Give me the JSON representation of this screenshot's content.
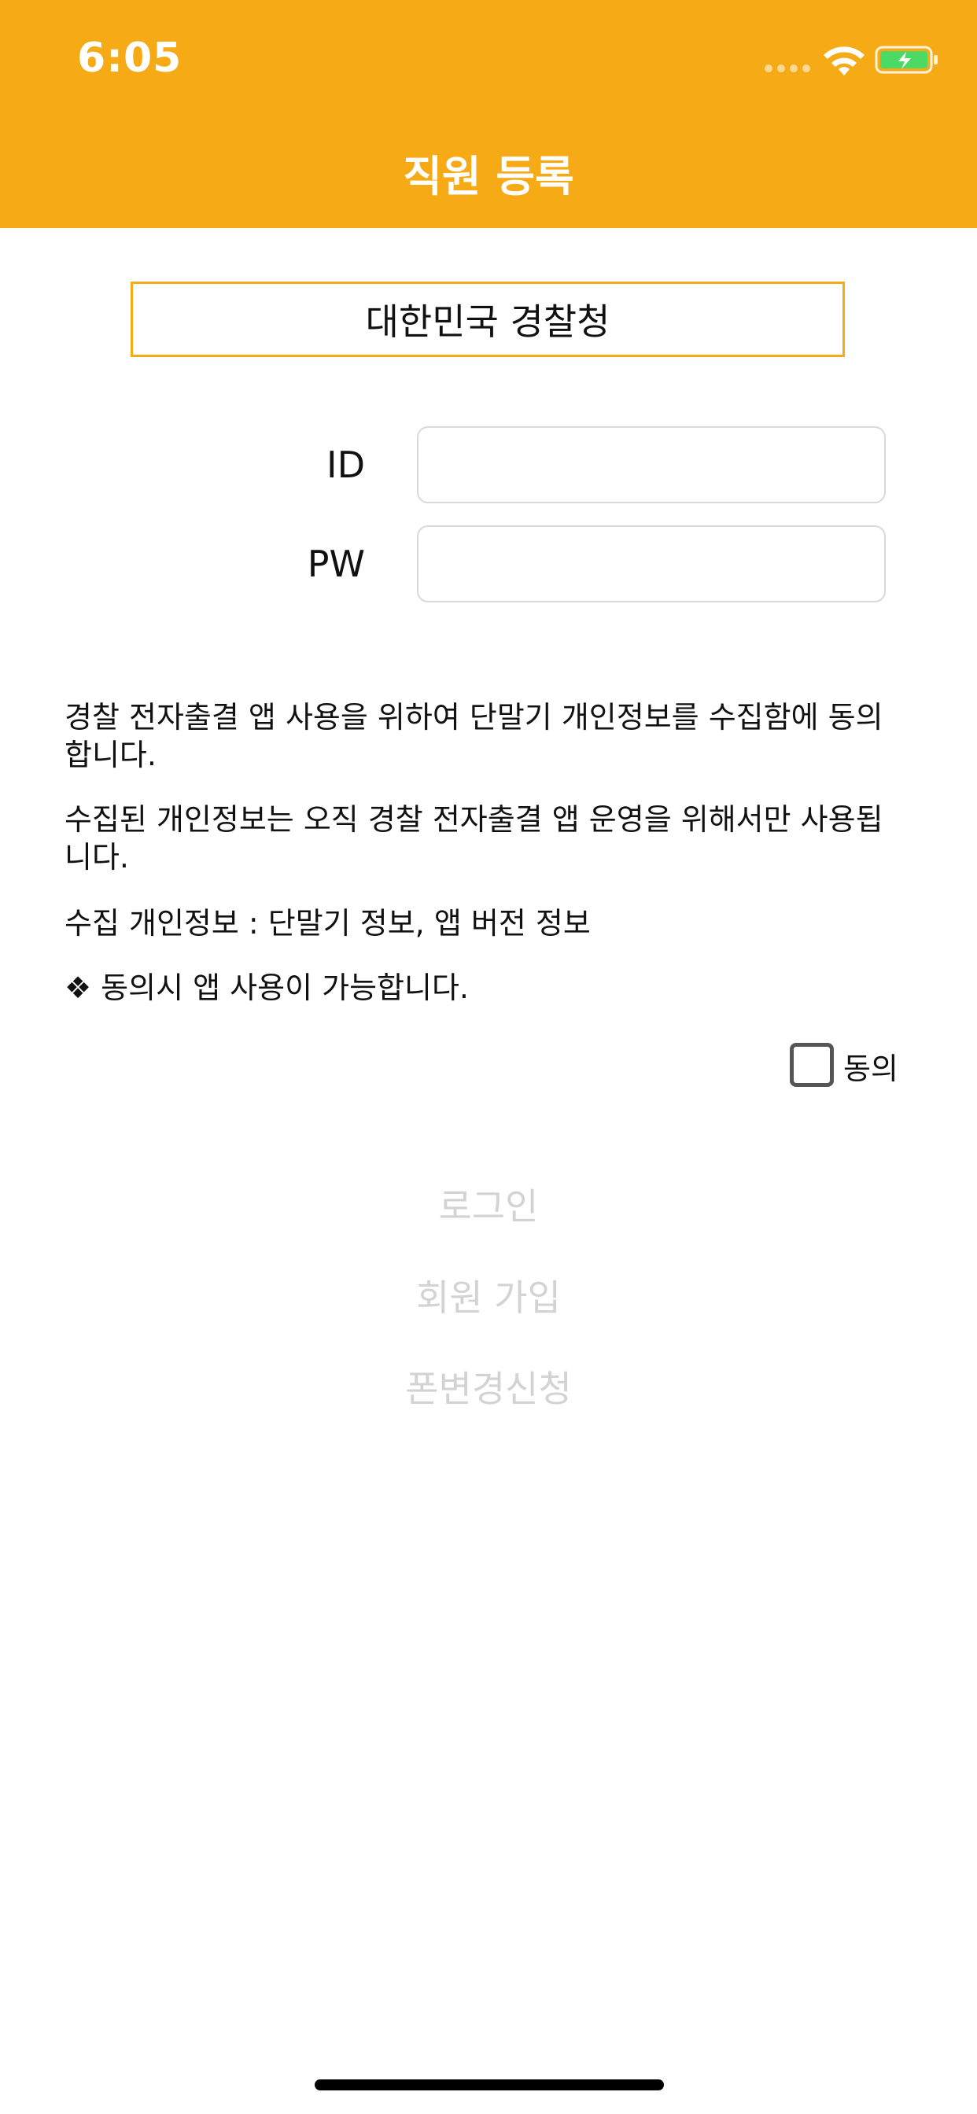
{
  "status_bar": {
    "time": "6:05"
  },
  "nav": {
    "title": "직원 등록"
  },
  "agency": {
    "name": "대한민국 경찰청"
  },
  "form": {
    "id_label": "ID",
    "id_value": "",
    "pw_label": "PW",
    "pw_value": ""
  },
  "consent": {
    "line1": "경찰 전자출결 앱 사용을 위하여 단말기 개인정보를 수집함에 동의 합니다.",
    "line2": "수집된 개인정보는 오직 경찰 전자출결 앱 운영을 위해서만 사용됩 니다.",
    "line3": "수집 개인정보 : 단말기 정보, 앱 버전 정보",
    "line4": "❖ 동의시 앱 사용이 가능합니다.",
    "agree_label": "동의",
    "agree_checked": false
  },
  "actions": {
    "login": "로그인",
    "signup": "회원 가입",
    "phone_change": "폰변경신청"
  },
  "colors": {
    "accent": "#F5AA16",
    "disabled_text": "#D3D3D3",
    "battery_fill": "#4CD964"
  },
  "icons": {
    "wifi": "wifi-icon",
    "battery": "battery-charging-icon",
    "signal": "cellular-signal-icon",
    "checkbox": "checkbox-unchecked-icon"
  }
}
